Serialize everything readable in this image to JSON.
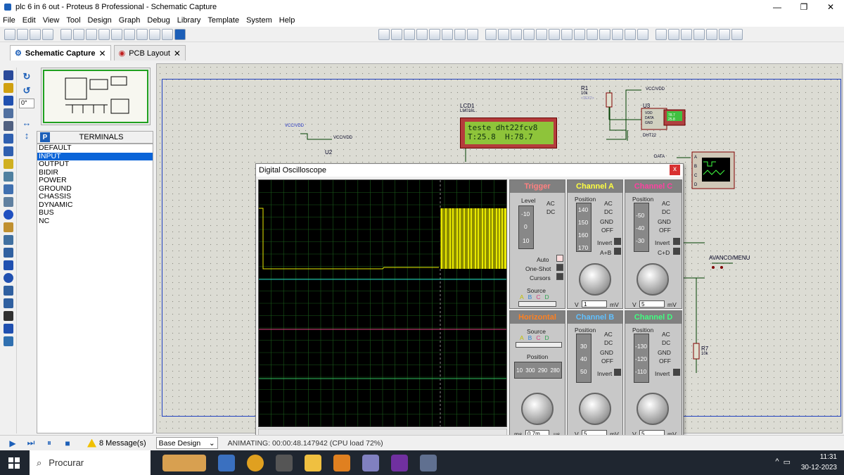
{
  "window": {
    "title": "plc 6 in 6 out - Proteus 8 Professional - Schematic Capture",
    "min": "—",
    "max": "❐",
    "close": "✕"
  },
  "menu": [
    "File",
    "Edit",
    "View",
    "Tool",
    "Design",
    "Graph",
    "Debug",
    "Library",
    "Template",
    "System",
    "Help"
  ],
  "tabs": [
    {
      "label": "Schematic Capture",
      "close": "✕"
    },
    {
      "label": "PCB Layout",
      "close": "✕"
    }
  ],
  "angle": "0°",
  "terminals": {
    "mode_letter": "P",
    "header": "TERMINALS",
    "items": [
      "DEFAULT",
      "INPUT",
      "OUTPUT",
      "BIDIR",
      "POWER",
      "GROUND",
      "CHASSIS",
      "DYNAMIC",
      "BUS",
      "NC"
    ],
    "selected": "INPUT"
  },
  "schematic": {
    "lcd_ref": "LCD1",
    "lcd_part": "LM016L",
    "lcd_line1": "teste dht22fcv8",
    "lcd_line2": "T:25.8  H:78.7",
    "r1_ref": "R1",
    "r1_val": "10k",
    "text_tag": "<TEXT>",
    "u3_ref": "U3",
    "u3_part": "DHT22",
    "u2_ref": "U2",
    "vcc_label": "VCC/VDD",
    "data_label": "DATA",
    "r7_ref": "R7",
    "r7_val": "10k",
    "btn_label": "AVANCO/MENU",
    "dht_display": "78.7",
    "dht_display2": "25.8",
    "dht_pins": [
      "VDD",
      "DATA",
      "GND"
    ],
    "scope_pins": [
      "A",
      "B",
      "C",
      "D"
    ]
  },
  "oscilloscope": {
    "title": "Digital Oscilloscope",
    "close": "x",
    "trigger": {
      "header": "Trigger",
      "level": "Level",
      "ac": "AC",
      "dc": "DC",
      "auto": "Auto",
      "oneshot": "One-Shot",
      "cursors": "Cursors",
      "source": "Source",
      "source_opts": [
        "A",
        "B",
        "C",
        "D"
      ],
      "scale": [
        "-10",
        "0",
        "10"
      ]
    },
    "channel_a": {
      "header": "Channel A",
      "position": "Position",
      "scale": [
        "140",
        "150",
        "160",
        "170"
      ],
      "modes": [
        "AC",
        "DC",
        "GND",
        "OFF"
      ],
      "invert": "Invert",
      "combine": "A+B",
      "value": "1",
      "unit_v": "V",
      "unit_mv": "mV"
    },
    "channel_c": {
      "header": "Channel C",
      "position": "Position",
      "scale": [
        "-50",
        "-40",
        "-30"
      ],
      "modes": [
        "AC",
        "DC",
        "GND",
        "OFF"
      ],
      "invert": "Invert",
      "combine": "C+D",
      "value": "5",
      "unit_v": "V",
      "unit_mv": "mV"
    },
    "horizontal": {
      "header": "Horizontal",
      "source": "Source",
      "source_opts": [
        "A",
        "B",
        "C",
        "D"
      ],
      "position": "Position",
      "scale": [
        "10",
        "300",
        "290",
        "280"
      ],
      "value": "0.7m",
      "unit_ms": "ms",
      "unit_us": "µs"
    },
    "channel_b": {
      "header": "Channel B",
      "position": "Position",
      "scale": [
        "30",
        "40",
        "50"
      ],
      "modes": [
        "AC",
        "DC",
        "GND",
        "OFF"
      ],
      "invert": "Invert",
      "value": "5",
      "unit_v": "V",
      "unit_mv": "mV"
    },
    "channel_d": {
      "header": "Channel D",
      "position": "Position",
      "scale": [
        "-130",
        "-120",
        "-110"
      ],
      "modes": [
        "AC",
        "DC",
        "GND",
        "OFF"
      ],
      "invert": "Invert",
      "value": "5",
      "unit_v": "V",
      "unit_mv": "mV"
    },
    "colors": {
      "trace_a": "#e8e800",
      "trace_b": "#20d0c8",
      "trace_c": "#e04080",
      "trace_d": "#30c060",
      "grid": "#1a5a1a",
      "trigger_hdr": "#ff8080",
      "a_hdr": "#ffff40",
      "c_hdr": "#ff40a0",
      "h_hdr": "#ff8020",
      "b_hdr": "#60c0ff",
      "d_hdr": "#40ff80"
    }
  },
  "status": {
    "messages": "8 Message(s)",
    "design": "Base Design",
    "animating": "ANIMATING: 00:00:48.147942 (CPU load 72%)"
  },
  "taskbar": {
    "search": "Procurar",
    "time": "11:31",
    "date": "30-12-2023",
    "chevron": "^"
  }
}
